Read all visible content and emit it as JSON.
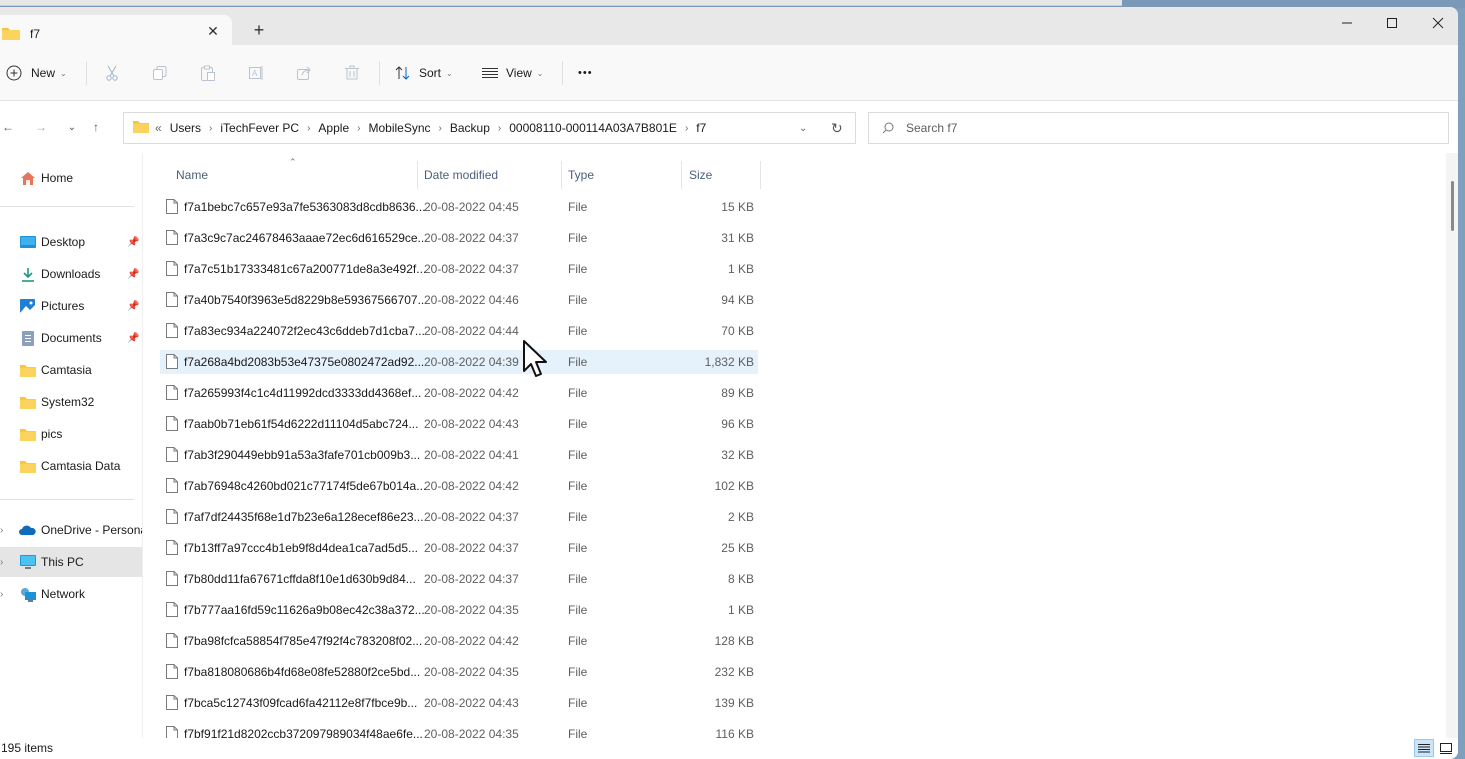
{
  "window": {
    "tab_title": "f7",
    "new_tab_icon": "plus-icon",
    "controls": {
      "minimize": "minimize-icon",
      "maximize": "maximize-icon",
      "close": "close-icon"
    }
  },
  "toolbar": {
    "new_label": "New",
    "sort_label": "Sort",
    "view_label": "View",
    "more_label": "•••",
    "icons": [
      "cut-icon",
      "copy-icon",
      "paste-icon",
      "rename-icon",
      "share-icon",
      "delete-icon"
    ]
  },
  "address": {
    "overflow": "«",
    "crumbs": [
      "Users",
      "iTechFever PC",
      "Apple",
      "MobileSync",
      "Backup",
      "00008110-000114A03A7B801E",
      "f7"
    ]
  },
  "search": {
    "placeholder": "Search f7",
    "value": ""
  },
  "sidebar": {
    "home": "Home",
    "quick_access": [
      {
        "label": "Desktop",
        "icon": "desktop-icon",
        "pinned": true
      },
      {
        "label": "Downloads",
        "icon": "download-icon",
        "pinned": true
      },
      {
        "label": "Pictures",
        "icon": "pictures-icon",
        "pinned": true
      },
      {
        "label": "Documents",
        "icon": "documents-icon",
        "pinned": true
      },
      {
        "label": "Camtasia",
        "icon": "folder-icon",
        "pinned": false
      },
      {
        "label": "System32",
        "icon": "folder-icon",
        "pinned": false
      },
      {
        "label": "pics",
        "icon": "folder-icon",
        "pinned": false
      },
      {
        "label": "Camtasia Data",
        "icon": "folder-icon",
        "pinned": false
      }
    ],
    "locations": [
      {
        "label": "OneDrive - Persona",
        "icon": "onedrive-icon",
        "selected": false
      },
      {
        "label": "This PC",
        "icon": "this-pc-icon",
        "selected": true
      },
      {
        "label": "Network",
        "icon": "network-icon",
        "selected": false
      }
    ]
  },
  "columns": {
    "name": "Name",
    "date": "Date modified",
    "type": "Type",
    "size": "Size"
  },
  "files": [
    {
      "name": "f7a1bebc7c657e93a7fe5363083d8cdb8636...",
      "date": "20-08-2022 04:45",
      "type": "File",
      "size": "15 KB"
    },
    {
      "name": "f7a3c9c7ac24678463aaae72ec6d616529ce...",
      "date": "20-08-2022 04:37",
      "type": "File",
      "size": "31 KB"
    },
    {
      "name": "f7a7c51b17333481c67a200771de8a3e492f...",
      "date": "20-08-2022 04:37",
      "type": "File",
      "size": "1 KB"
    },
    {
      "name": "f7a40b7540f3963e5d8229b8e59367566707...",
      "date": "20-08-2022 04:46",
      "type": "File",
      "size": "94 KB"
    },
    {
      "name": "f7a83ec934a224072f2ec43c6ddeb7d1cba7...",
      "date": "20-08-2022 04:44",
      "type": "File",
      "size": "70 KB"
    },
    {
      "name": "f7a268a4bd2083b53e47375e0802472ad92...",
      "date": "20-08-2022 04:39",
      "type": "File",
      "size": "1,832 KB",
      "hover": true
    },
    {
      "name": "f7a265993f4c1c4d11992dcd3333dd4368ef...",
      "date": "20-08-2022 04:42",
      "type": "File",
      "size": "89 KB"
    },
    {
      "name": "f7aab0b71eb61f54d6222d11104d5abc724...",
      "date": "20-08-2022 04:43",
      "type": "File",
      "size": "96 KB"
    },
    {
      "name": "f7ab3f290449ebb91a53a3fafe701cb009b3...",
      "date": "20-08-2022 04:41",
      "type": "File",
      "size": "32 KB"
    },
    {
      "name": "f7ab76948c4260bd021c77174f5de67b014a...",
      "date": "20-08-2022 04:42",
      "type": "File",
      "size": "102 KB"
    },
    {
      "name": "f7af7df24435f68e1d7b23e6a128ecef86e23...",
      "date": "20-08-2022 04:37",
      "type": "File",
      "size": "2 KB"
    },
    {
      "name": "f7b13ff7a97ccc4b1eb9f8d4dea1ca7ad5d5...",
      "date": "20-08-2022 04:37",
      "type": "File",
      "size": "25 KB"
    },
    {
      "name": "f7b80dd11fa67671cffda8f10e1d630b9d84...",
      "date": "20-08-2022 04:37",
      "type": "File",
      "size": "8 KB"
    },
    {
      "name": "f7b777aa16fd59c11626a9b08ec42c38a372...",
      "date": "20-08-2022 04:35",
      "type": "File",
      "size": "1 KB"
    },
    {
      "name": "f7ba98fcfca58854f785e47f92f4c783208f02...",
      "date": "20-08-2022 04:42",
      "type": "File",
      "size": "128 KB"
    },
    {
      "name": "f7ba818080686b4fd68e08fe52880f2ce5bd...",
      "date": "20-08-2022 04:35",
      "type": "File",
      "size": "232 KB"
    },
    {
      "name": "f7bca5c12743f09fcad6fa42112e8f7fbce9b...",
      "date": "20-08-2022 04:43",
      "type": "File",
      "size": "139 KB"
    },
    {
      "name": "f7bf91f21d8202ccb372097989034f48ae6fe...",
      "date": "20-08-2022 04:35",
      "type": "File",
      "size": "116 KB"
    }
  ],
  "status": {
    "item_count": "195 items"
  },
  "colors": {
    "accent": "#0067c0",
    "hover_row": "#e5f1fb",
    "selected_nav": "#e5e5e5",
    "folder": "#f8c93e"
  }
}
